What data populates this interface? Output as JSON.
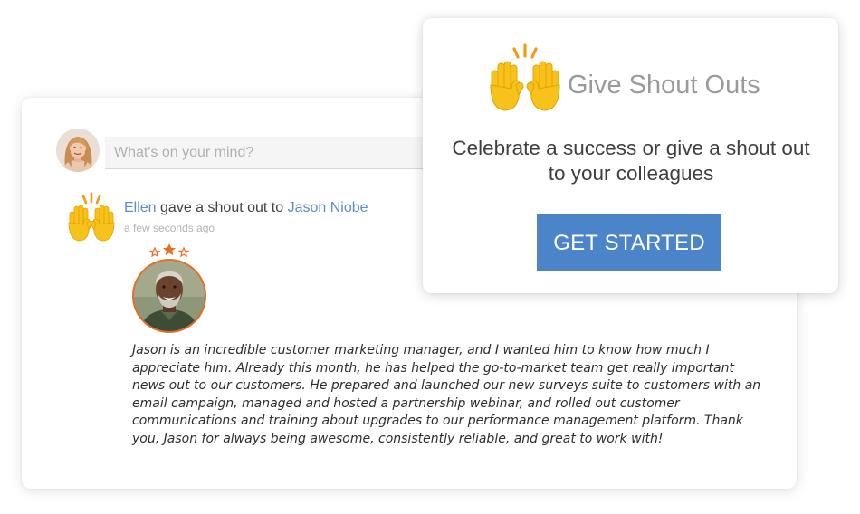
{
  "composer": {
    "placeholder": "What's on your mind?"
  },
  "activity": {
    "actor": "Ellen",
    "verb": "gave a shout out to",
    "recipient": "Jason Niobe",
    "timestamp": "a few seconds ago",
    "message": "Jason is an incredible customer marketing manager, and I wanted him to know how much I appreciate him. Already this month, he has helped the go-to-market team get really important news out to our customers. He prepared and launched our new surveys suite to customers with an email campaign, managed and hosted a partnership webinar, and rolled out customer communications and training about upgrades to our performance management platform. Thank you, Jason for always being awesome, consistently reliable, and great to work with!"
  },
  "promo": {
    "title": "Give Shout Outs",
    "headline": "Celebrate a success or give a shout out to your colleagues",
    "button_label": "GET STARTED"
  },
  "icons": {
    "activity": "raised-hands-icon",
    "promo": "raised-hands-icon",
    "badge": "stars-icon"
  },
  "colors": {
    "accent_blue": "#4c84c9",
    "link_blue": "#5b8ccb",
    "badge_orange": "#ea6c27",
    "hands_yellow": "#f7c21c"
  }
}
